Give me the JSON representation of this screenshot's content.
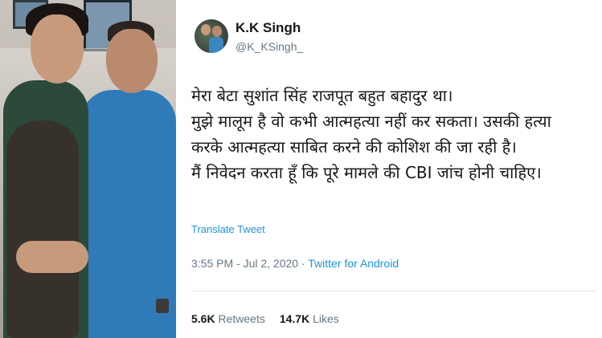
{
  "tweet": {
    "display_name": "K.K Singh",
    "handle": "@K_KSingh_",
    "lines": [
      "मेरा बेटा सुशांत सिंह राजपूत बहुत बहादुर था।",
      "मुझे मालूम है वो कभी आत्महत्या नहीं कर सकता। उसकी हत्या",
      "करके आत्महत्या साबित करने की कोशिश की जा रही है।",
      "मैं निवेदन करता हूँ कि पूरे मामले की CBI जांच होनी चाहिए।"
    ],
    "translate_label": "Translate Tweet",
    "timestamp": "3:55 PM - Jul 2, 2020",
    "separator": " · ",
    "source": "Twitter for Android",
    "retweets_count": "5.6K",
    "retweets_label": "Retweets",
    "likes_count": "14.7K",
    "likes_label": "Likes"
  },
  "colors": {
    "link": "#1b95e0",
    "text": "#14171a",
    "muted": "#657786"
  }
}
